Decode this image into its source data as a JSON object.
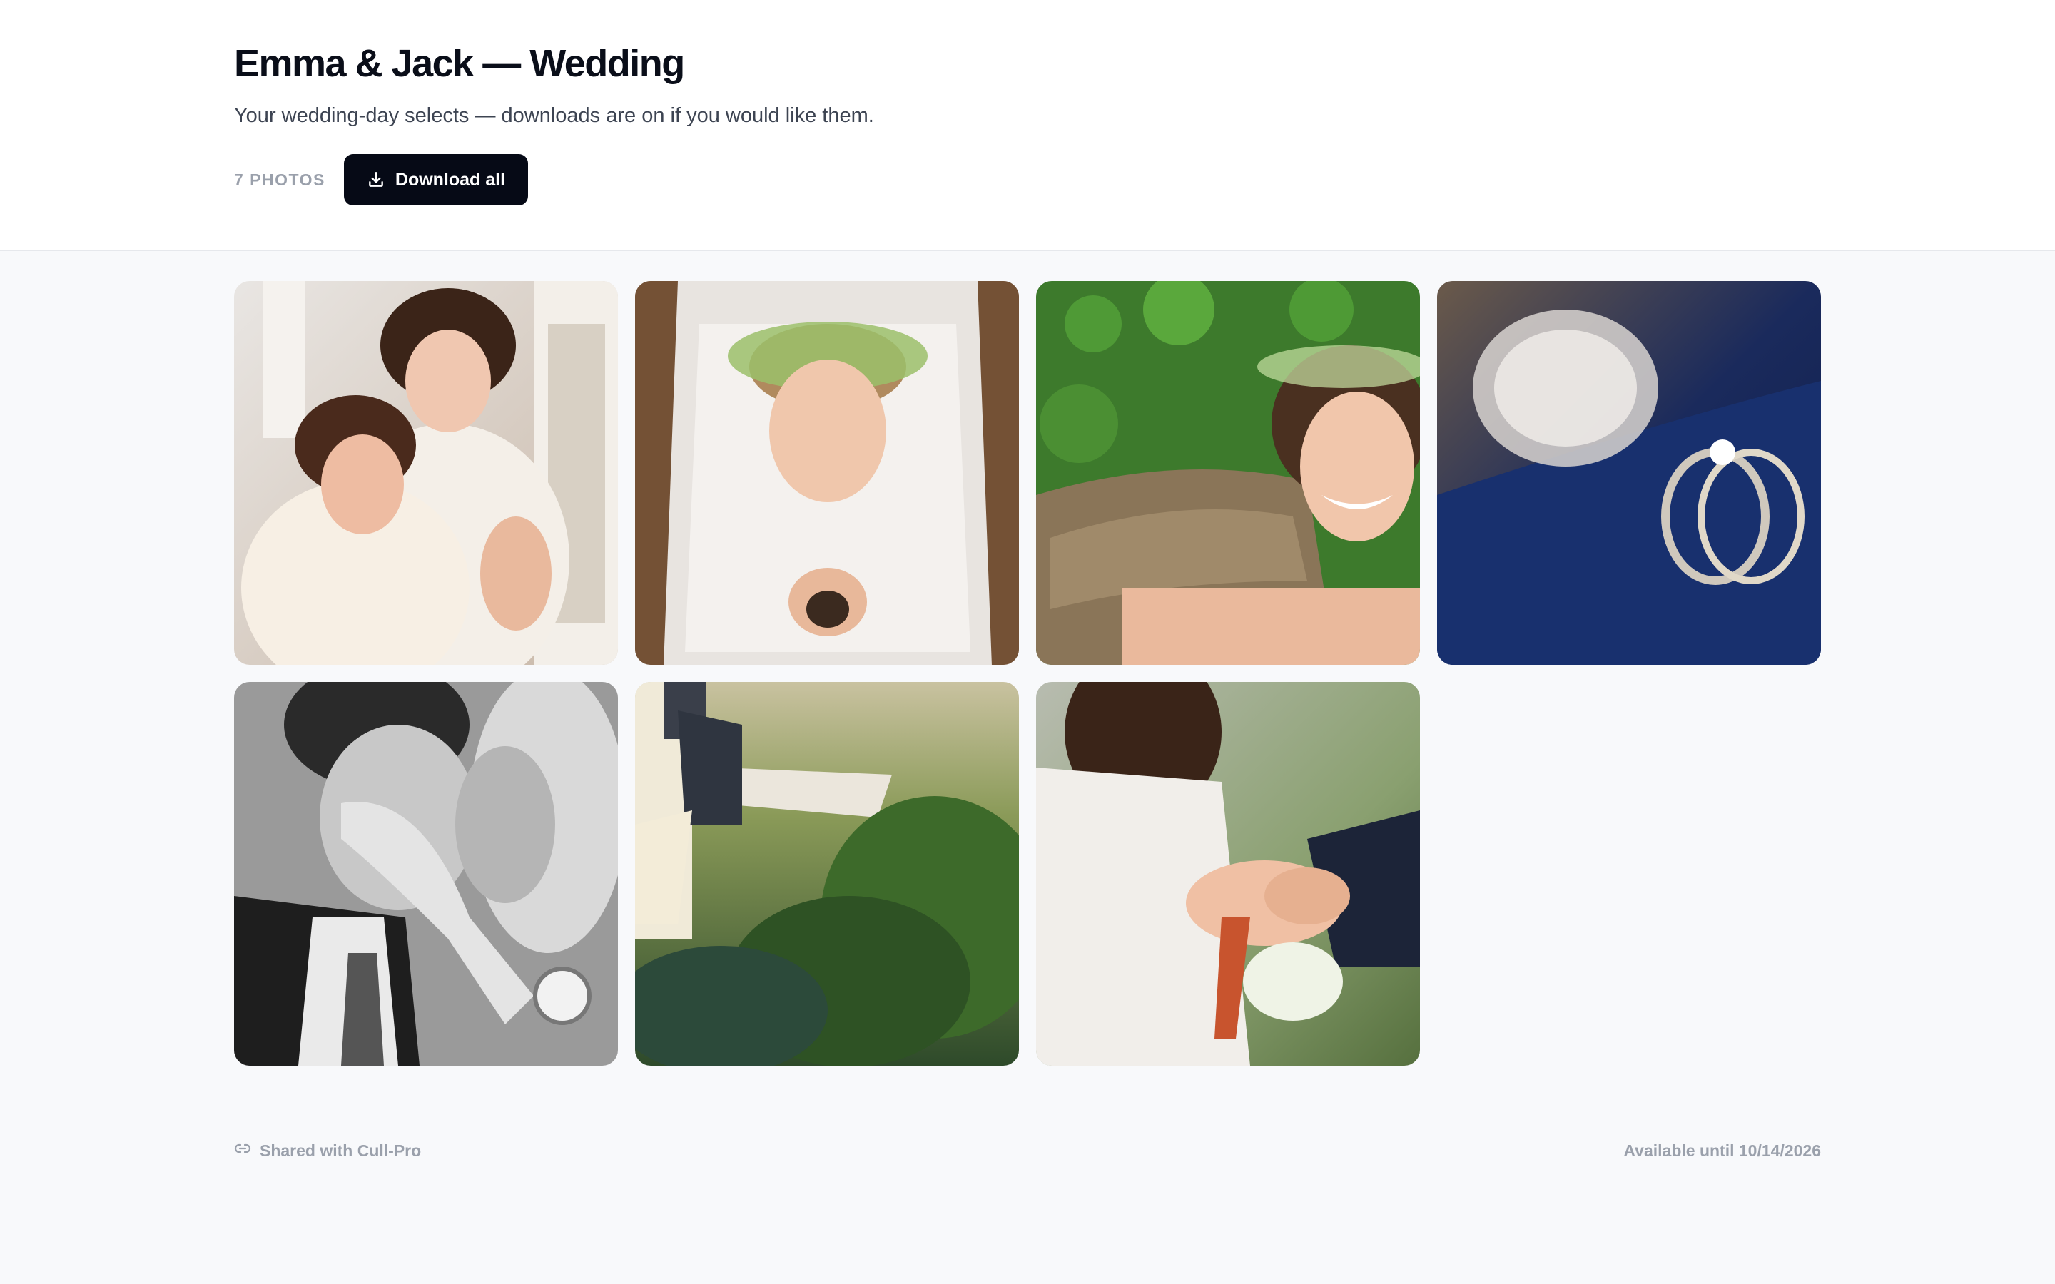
{
  "header": {
    "title": "Emma & Jack — Wedding",
    "subtitle": "Your wedding-day selects — downloads are on if you would like them.",
    "photo_count": "7 PHOTOS",
    "download_label": "Download all"
  },
  "gallery": {
    "photos": [
      {
        "subject": "bride-hugging-woman"
      },
      {
        "subject": "bride-flower-crown-from-above"
      },
      {
        "subject": "bride-lying-in-clover"
      },
      {
        "subject": "wedding-rings-on-suit"
      },
      {
        "subject": "couple-kissing-black-and-white"
      },
      {
        "subject": "couple-sitting-on-dock"
      },
      {
        "subject": "ring-exchange-with-bouquet"
      }
    ]
  },
  "footer": {
    "shared_text": "Shared with Cull-Pro",
    "availability": "Available until 10/14/2026"
  },
  "colors": {
    "accent": "#060a16",
    "page_background": "#f8f9fb",
    "muted_text": "#9aa0ab"
  },
  "icons": {
    "download": "download-icon",
    "link": "link-icon"
  }
}
